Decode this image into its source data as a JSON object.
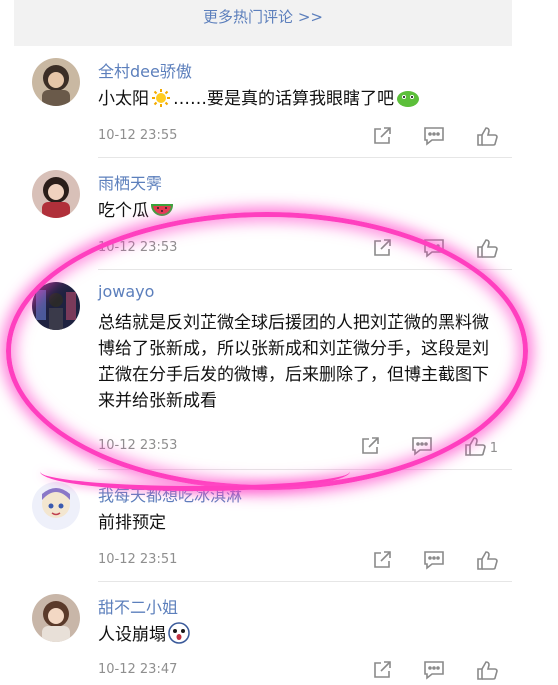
{
  "more_comments": {
    "label": "更多热门评论 >>"
  },
  "comments": [
    {
      "user": "全村dee骄傲",
      "pre": "小太阳",
      "post": "……要是真的话算我眼瞎了吧",
      "time": "10-12 23:55",
      "likes": ""
    },
    {
      "user": "雨栖天霁",
      "pre": "吃个瓜",
      "post": "",
      "time": "10-12 23:53",
      "likes": ""
    },
    {
      "user": "jowayo",
      "pre": "总结就是反刘芷微全球后援团的人把刘芷微的黑料微博给了张新成，所以张新成和刘芷微分手，这段是刘芷微在分手后发的微博，后来删除了，但博主截图下来并给张新成看",
      "post": "",
      "time": "10-12 23:53",
      "likes": "1"
    },
    {
      "user": "我每天都想吃冰淇淋",
      "pre": "前排预定",
      "post": "",
      "time": "10-12 23:51",
      "likes": ""
    },
    {
      "user": "甜不二小姐",
      "pre": "人设崩塌",
      "post": "",
      "time": "10-12 23:47",
      "likes": ""
    }
  ],
  "icons": {
    "share": "share-icon",
    "comment": "comment-icon",
    "like": "like-icon"
  },
  "colors": {
    "username": "#5c7fbc",
    "highlight": "#ff3fbf",
    "time": "#8f8f8f"
  }
}
